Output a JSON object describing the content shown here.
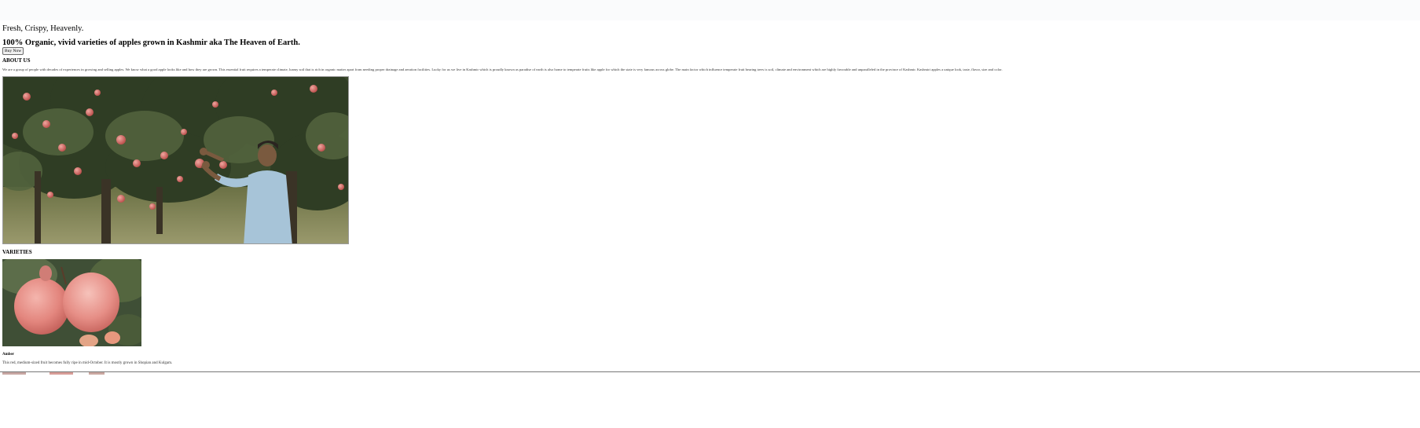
{
  "hero": {
    "tagline": "Fresh, Crispy, Heavenly.",
    "subheadline": "100% Organic, vivid varieties of apples grown in Kashmir aka The Heaven of Earth.",
    "buy_button_label": "Buy Now"
  },
  "about": {
    "heading": "ABOUT US",
    "text": "We are a group of people with decades of experiences in growing and selling apples. We know what a good apple looks like and how they are grown. This essential fruit requires a temperate climate, loamy soil that is rich in organic matter apart from needing proper drainage and aeration facilities. Lucky for us we live in Kashmir which is proudly known as paradise of earth is also home to temperate fruits like apple for which the state is very famous across globe. The main factor which influence temperate fruit bearing trees is soil, climate and environment which are highly favorable and unparalleled in the province of Kashmir. Kashmiri apples a unique look, taste, flavor, size and color.",
    "photo_icon": "apple-orchard-farmer-photo"
  },
  "varieties": {
    "heading": "VARIETIES",
    "items": [
      {
        "name": "Amber",
        "description": "This red, medium-sized fruit becomes fully ripe in mid-October. It is mostly grown in Shopian and Kulgam.",
        "photo_icon": "red-apples-photo"
      }
    ]
  },
  "colors": {
    "leaf_dark": "#2f3d24",
    "leaf_mid": "#4a5a37",
    "apple_red": "#c4524f",
    "apple_pink": "#e38680",
    "grass": "#8c8f5e",
    "shirt": "#a7c4d8"
  }
}
